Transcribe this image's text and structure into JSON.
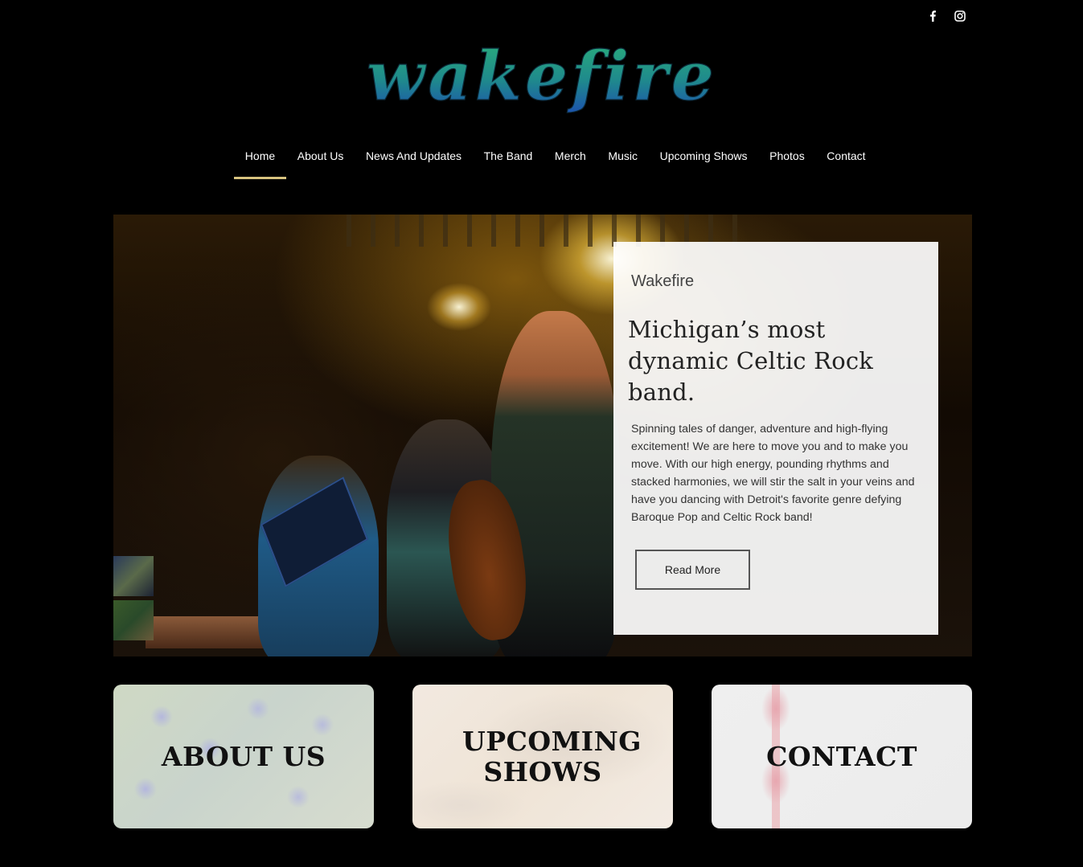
{
  "social": [
    {
      "name": "facebook-icon",
      "glyph": "f"
    },
    {
      "name": "instagram-icon",
      "glyph": ""
    }
  ],
  "logo": {
    "text": "wakefire"
  },
  "colors": {
    "accent": "#d8c37f",
    "logo_top": "#2bb07a",
    "logo_bottom": "#1c4fb0"
  },
  "nav": [
    {
      "label": "Home",
      "active": true
    },
    {
      "label": "About Us"
    },
    {
      "label": "News And Updates"
    },
    {
      "label": "The Band"
    },
    {
      "label": "Merch"
    },
    {
      "label": "Music"
    },
    {
      "label": "Upcoming Shows"
    },
    {
      "label": "Photos"
    },
    {
      "label": "Contact"
    }
  ],
  "hero": {
    "eyebrow": "Wakefire",
    "headline": "Michigan’s most dynamic Celtic Rock band.",
    "body": "Spinning tales of danger, adventure and high-flying excitement! We are here to move you and to make you move. With our high energy, pounding rhythms and stacked harmonies, we will stir the salt in your veins and have you dancing with Detroit's favorite genre defying Baroque Pop and Celtic Rock band!",
    "button": "Read More"
  },
  "tiles": {
    "about": "ABOUT US",
    "shows": "UPCOMING SHOWS",
    "contact": "CONTACT"
  }
}
